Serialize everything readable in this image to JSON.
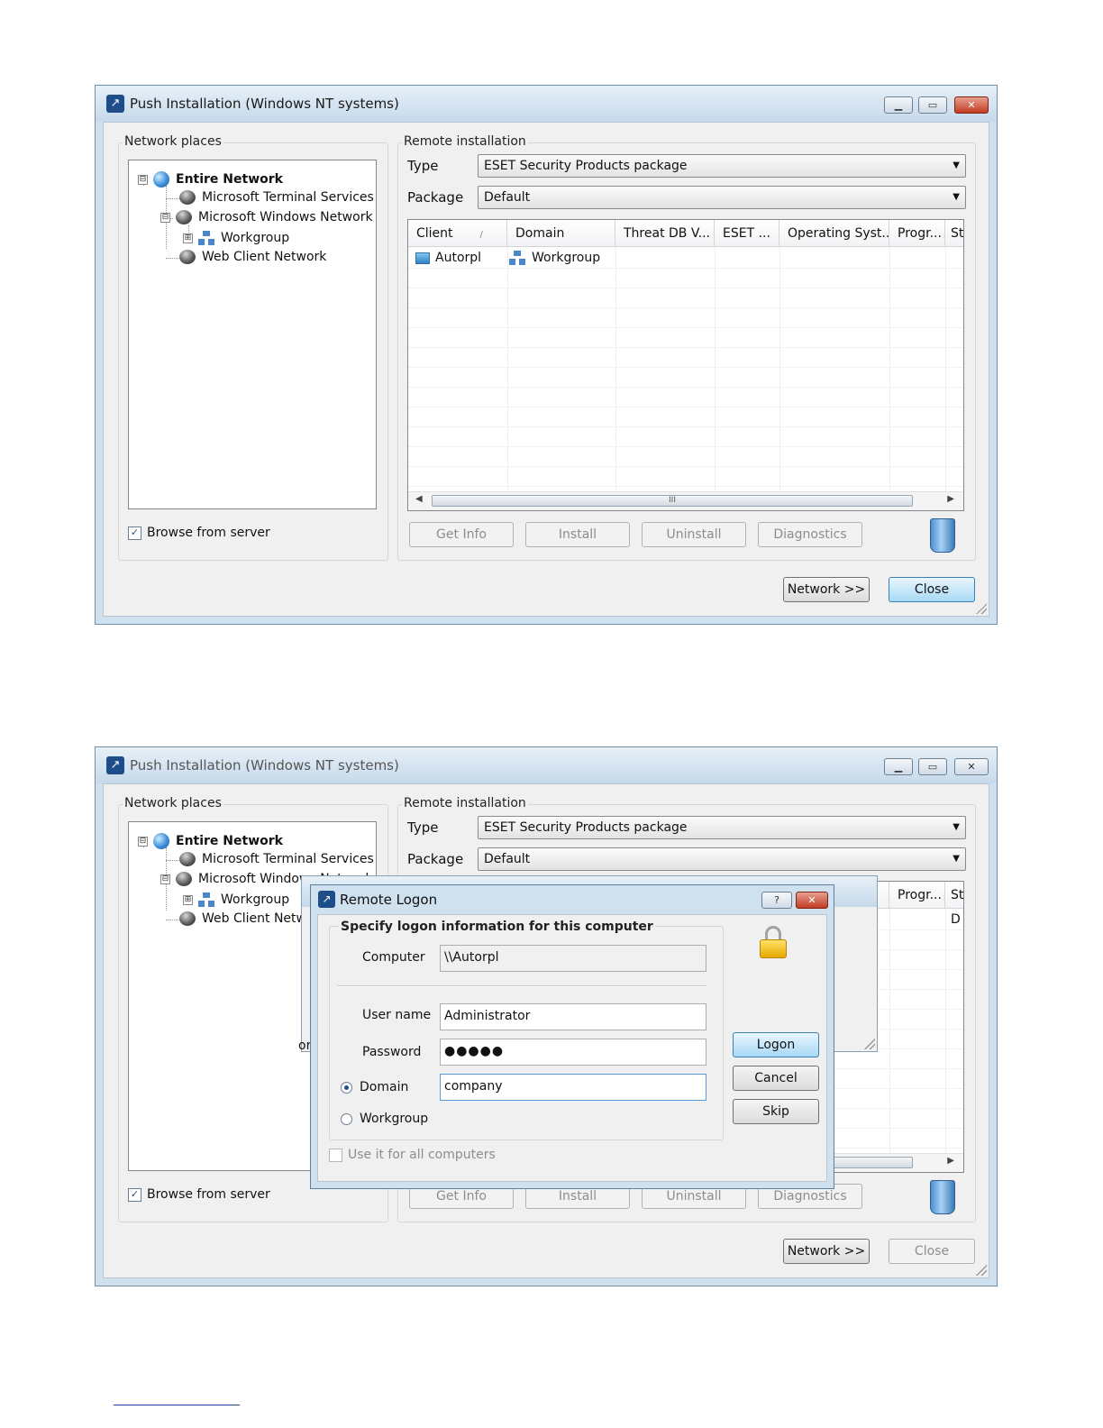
{
  "window": {
    "title": "Push Installation (Windows NT systems)",
    "network_places_label": "Network places",
    "remote_installation_label": "Remote installation",
    "tree": [
      {
        "label": "Entire Network",
        "icon": "globe-icon",
        "expander": "⊟"
      },
      {
        "label": "Microsoft Terminal Services",
        "icon": "network-icon"
      },
      {
        "label": "Microsoft Windows Network",
        "icon": "network-icon",
        "expander": "⊟"
      },
      {
        "label": "Workgroup",
        "icon": "workgroup-icon",
        "expander": "⊞"
      },
      {
        "label": "Web Client Network",
        "icon": "network-icon"
      }
    ],
    "browse_from_server": "Browse from server",
    "type_label": "Type",
    "type_value": "ESET Security Products package",
    "package_label": "Package",
    "package_value": "Default",
    "columns": [
      "Client",
      "Domain",
      "Threat DB V...",
      "ESET ...",
      "Operating Syst...",
      "Progr...",
      "St"
    ],
    "sort_indicator": "/",
    "rows": [
      {
        "client": "Autorpl",
        "domain": "Workgroup"
      }
    ],
    "scroll_grip": "III",
    "buttons": {
      "get_info": "Get Info",
      "install": "Install",
      "uninstall": "Uninstall",
      "diagnostics": "Diagnostics",
      "network": "Network >>",
      "close": "Close"
    }
  },
  "window2": {
    "partial_tree_label": "Web Client Netw",
    "partial_column_tail": "."
  },
  "dialog": {
    "title": "Remote Logon",
    "heading": "Specify logon information for this computer",
    "computer_label": "Computer",
    "computer_value": "\\\\Autorpl",
    "username_label": "User name",
    "username_value": "Administrator",
    "password_label": "Password",
    "password_value": "●●●●●",
    "domain_label": "Domain",
    "domain_value": "company",
    "workgroup_label": "Workgroup",
    "use_for_all": "Use it for all computers",
    "buttons": {
      "logon": "Logon",
      "cancel": "Cancel",
      "skip": "Skip"
    },
    "behind_fragments": {
      "st_cell": "D",
      "or_text": "or"
    }
  },
  "colors": {
    "window_frame": "#cfe0ee",
    "close_red": "#c23b22",
    "default_button": "#a7d9f5"
  }
}
